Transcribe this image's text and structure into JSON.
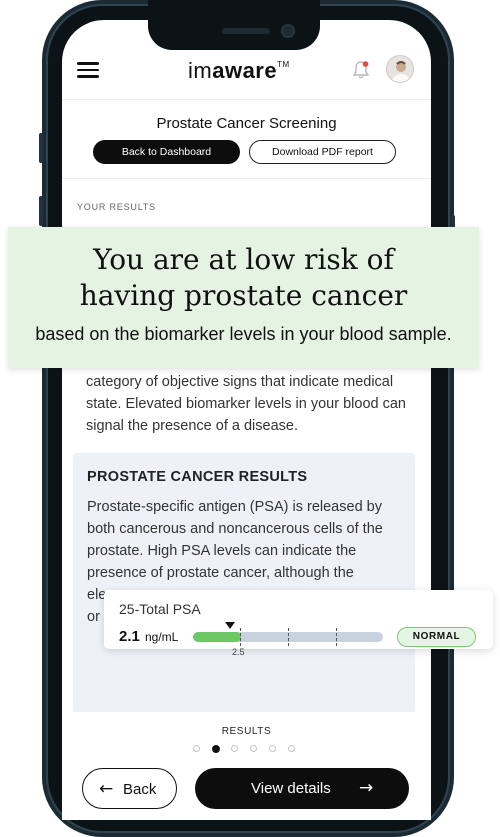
{
  "header": {
    "logo_prefix": "im",
    "logo_main": "aware",
    "logo_mark": "TM",
    "menu_icon": "hamburger-menu-icon",
    "notification_icon": "bell-icon",
    "notification_dot_color": "#e8493f"
  },
  "page": {
    "title": "Prostate Cancer Screening",
    "back_to_dashboard": "Back to Dashboard",
    "download_pdf": "Download PDF report",
    "section_label": "YOUR RESULTS"
  },
  "hero": {
    "line1": "You are at low risk of",
    "line2": "having prostate cancer",
    "subtitle": "based on the biomarker levels in your blood sample."
  },
  "intro_text": "category of objective signs that indicate medical state. Elevated biomarker levels in your blood can signal the presence of a disease.",
  "card": {
    "title": "PROSTATE CANCER RESULTS",
    "text_lines": [
      "Prostate-specific antigen (PSA) is released by",
      "both cancerous and noncancerous cells of the",
      "prostate. High PSA levels can indicate the",
      "presence of prostate cancer, although the",
      "ele",
      "or"
    ]
  },
  "psa": {
    "name": "25-Total PSA",
    "value": "2.1",
    "unit": "ng/mL",
    "threshold_label": "2.5",
    "fill_fraction": 0.25,
    "status": "NORMAL"
  },
  "footer": {
    "section": "RESULTS",
    "dot_count": 6,
    "active_dot": 1,
    "back_label": "Back",
    "back_icon": "arrow-left-icon",
    "next_label": "View details",
    "next_icon": "arrow-right-icon"
  },
  "colors": {
    "hero_bg": "#e5f3e3",
    "bar_fill": "#6cc864",
    "bar_track": "#c9d3e0",
    "badge_border": "#7dc876",
    "card_bg": "#eef2f8"
  }
}
